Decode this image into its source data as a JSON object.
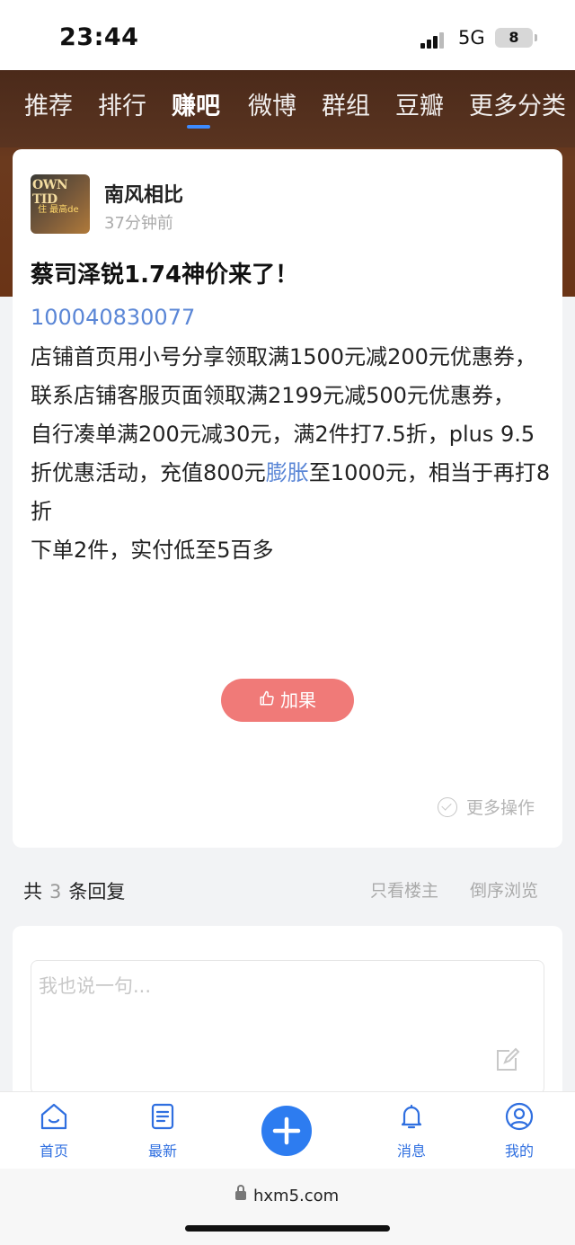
{
  "status_bar": {
    "time": "23:44",
    "network": "5G",
    "battery": "8"
  },
  "nav_tabs": [
    {
      "label": "推荐",
      "active": false
    },
    {
      "label": "排行",
      "active": false
    },
    {
      "label": "赚吧",
      "active": true
    },
    {
      "label": "微博",
      "active": false
    },
    {
      "label": "群组",
      "active": false
    },
    {
      "label": "豆瓣",
      "active": false
    },
    {
      "label": "更多分类",
      "active": false
    }
  ],
  "post": {
    "author": "南风相比",
    "time": "37分钟前",
    "avatar_text": "OWN TID",
    "avatar_sub": "住 最高de",
    "title": "蔡司泽锐1.74神价来了！",
    "product_id": "100040830077",
    "body_part1": "店铺首页用小号分享领取满1500元减200元优惠券，联系店铺客服页面领取满2199元减500元优惠券，",
    "body_part2": "自行凑单满200元减30元，满2件打7.5折，plus 9.5折优惠活动，充值800元",
    "body_link": "膨胀",
    "body_part3": "至1000元，相当于再打8折",
    "body_part4": "下单2件，实付低至5百多",
    "like_label": "加果",
    "more_ops": "更多操作"
  },
  "replies": {
    "prefix": "共",
    "count": "3",
    "suffix": "条回复",
    "only_op": "只看楼主",
    "reverse": "倒序浏览"
  },
  "comment": {
    "placeholder": "我也说一句..."
  },
  "bottom_nav": [
    {
      "label": "首页",
      "icon": "home-icon"
    },
    {
      "label": "最新",
      "icon": "document-icon"
    },
    {
      "label": "",
      "icon": "plus-icon"
    },
    {
      "label": "消息",
      "icon": "bell-icon"
    },
    {
      "label": "我的",
      "icon": "user-icon"
    }
  ],
  "browser": {
    "url": "hxm5.com"
  },
  "colors": {
    "accent": "#2d7cf0",
    "link": "#5a86d6",
    "like": "#f07a78",
    "hero": "#6b3a1e"
  }
}
